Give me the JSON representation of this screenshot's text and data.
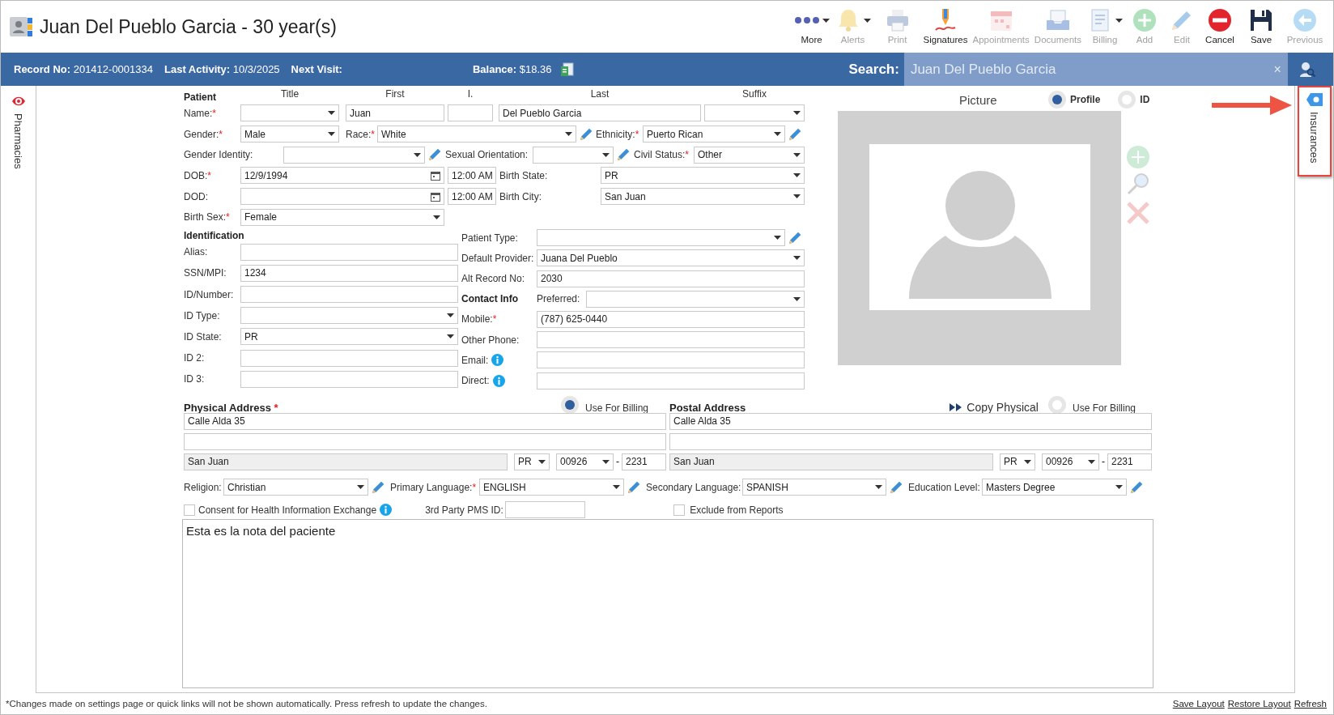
{
  "header": {
    "title": "Juan Del Pueblo Garcia - 30 year(s)"
  },
  "toolbar": [
    {
      "kind": "more",
      "label": "More",
      "disabled": false,
      "dropdown": true
    },
    {
      "kind": "alerts",
      "label": "Alerts",
      "disabled": true,
      "dropdown": true
    },
    {
      "kind": "print",
      "label": "Print",
      "disabled": true,
      "dropdown": false
    },
    {
      "kind": "signatures",
      "label": "Signatures",
      "disabled": false,
      "dropdown": false
    },
    {
      "kind": "appointments",
      "label": "Appointments",
      "disabled": true,
      "dropdown": false
    },
    {
      "kind": "documents",
      "label": "Documents",
      "disabled": true,
      "dropdown": false
    },
    {
      "kind": "billing",
      "label": "Billing",
      "disabled": true,
      "dropdown": true
    },
    {
      "kind": "add",
      "label": "Add",
      "disabled": true,
      "dropdown": false
    },
    {
      "kind": "edit",
      "label": "Edit",
      "disabled": true,
      "dropdown": false
    },
    {
      "kind": "cancel",
      "label": "Cancel",
      "disabled": false,
      "dropdown": false
    },
    {
      "kind": "save",
      "label": "Save",
      "disabled": false,
      "dropdown": false
    },
    {
      "kind": "previous",
      "label": "Previous",
      "disabled": true,
      "dropdown": false
    }
  ],
  "info_bar": {
    "record": "**Record No:** 201412-0001334",
    "activity": "**Last Activity:** 10/3/2025",
    "next_visit": "Next Visit:",
    "balance": "**Balance:** $18.36",
    "search_label": "Search:",
    "search_value": "Juan Del Pueblo Garcia",
    "clear": "×"
  },
  "side_tabs": {
    "left": {
      "label": "Pharmacies",
      "highlighted": false
    },
    "right": {
      "label": "Insurances",
      "highlighted": true
    }
  },
  "patient": {
    "heading": "Patient",
    "column_headers": [
      "Title",
      "First",
      "I.",
      "Last",
      "Suffix"
    ],
    "name": {
      "label": "Name:",
      "required_mark": "*",
      "first": "Juan",
      "last": "Del Pueblo Garcia"
    },
    "gender": {
      "label": "Gender:",
      "required_mark": "*",
      "value": "Male"
    },
    "race": {
      "label": "Race:",
      "required_mark": "*",
      "value": "White"
    },
    "ethnicity": {
      "label": "Ethnicity:",
      "required_mark": "*",
      "value": "Puerto Rican"
    },
    "gender_identity": {
      "label": "Gender Identity:"
    },
    "sexual_orientation": {
      "label": "Sexual Orientation:"
    },
    "civil_status": {
      "label": "Civil Status:",
      "required_mark": "*",
      "value": "Other"
    },
    "dob": {
      "label": "DOB:",
      "required_mark": "*",
      "value": "12/9/1994",
      "time": "12:00 AM"
    },
    "birth_state": {
      "label": "Birth State:",
      "value": "PR"
    },
    "dod": {
      "label": "DOD:",
      "time": "12:00 AM"
    },
    "birth_city": {
      "label": "Birth City:",
      "value": "San Juan"
    },
    "birth_sex": {
      "label": "Birth Sex:",
      "required_mark": "*",
      "value": "Female"
    }
  },
  "identification": {
    "heading": "Identification",
    "fields": [
      {
        "kind": "text",
        "label": "Alias:"
      },
      {
        "kind": "text",
        "label": "SSN/MPI:",
        "value": "1234"
      },
      {
        "kind": "text",
        "label": "ID/Number:"
      },
      {
        "kind": "select",
        "label": "ID Type:"
      },
      {
        "kind": "select",
        "label": "ID State:",
        "value": "PR"
      },
      {
        "kind": "text",
        "label": "ID 2:"
      },
      {
        "kind": "text",
        "label": "ID 3:"
      }
    ]
  },
  "right_fields": [
    {
      "kind": "select",
      "label": "Patient Type:",
      "edit_button": true
    },
    {
      "kind": "select",
      "label": "Default Provider:",
      "value": "Juana Del Pueblo",
      "edit_button": false
    },
    {
      "kind": "text",
      "label": "Alt Record No:",
      "value": "2030",
      "info": false
    },
    {
      "kind": "heading_select",
      "heading": "Contact Info",
      "label": "Preferred:"
    },
    {
      "kind": "text",
      "label": "Mobile:",
      "required_mark": "*",
      "value": "(787) 625-0440",
      "info": false
    },
    {
      "kind": "text",
      "label": "Other Phone:",
      "info": false
    },
    {
      "kind": "text",
      "label": "Email:",
      "info": true
    },
    {
      "kind": "text",
      "label": "Direct:",
      "info": true
    }
  ],
  "picture": {
    "label": "Picture",
    "options": [
      {
        "label": "Profile",
        "selected": true
      },
      {
        "label": "ID",
        "selected": false
      }
    ]
  },
  "physical_address": {
    "title": "Physical Address",
    "required_mark": "*",
    "billing_label": "Use For Billing",
    "use_for_billing": true,
    "line1": "Calle Alda 35",
    "city": "San Juan",
    "state": "PR",
    "zip": "00926",
    "zip_separator": "-",
    "zip_ext": "2231"
  },
  "postal_address": {
    "title": "Postal Address",
    "copy": "Copy Physical",
    "billing_label": "Use For Billing",
    "use_for_billing": false,
    "line1": "Calle Alda 35",
    "city": "San Juan",
    "state": "PR",
    "zip": "00926",
    "zip_separator": "-",
    "zip_ext": "2231"
  },
  "details": [
    {
      "label": "Religion:",
      "value": "Christian"
    },
    {
      "label": "Primary Language:",
      "required_mark": "*",
      "value": "ENGLISH"
    },
    {
      "label": "Secondary Language:",
      "value": "SPANISH"
    },
    {
      "label": "Education Level:",
      "value": "Masters Degree"
    }
  ],
  "flags": {
    "consent": {
      "label": "Consent for Health Information Exchange",
      "checked": false
    },
    "pms_label": "3rd Party PMS ID:",
    "exclude": {
      "label": "Exclude from Reports",
      "checked": false
    }
  },
  "notes": "Esta es la nota del paciente",
  "footer": {
    "message": "*Changes made on settings page or quick links will not be shown automatically. Press refresh to update the changes.",
    "links": [
      "Save Layout",
      "Restore Layout",
      "Refresh"
    ]
  }
}
